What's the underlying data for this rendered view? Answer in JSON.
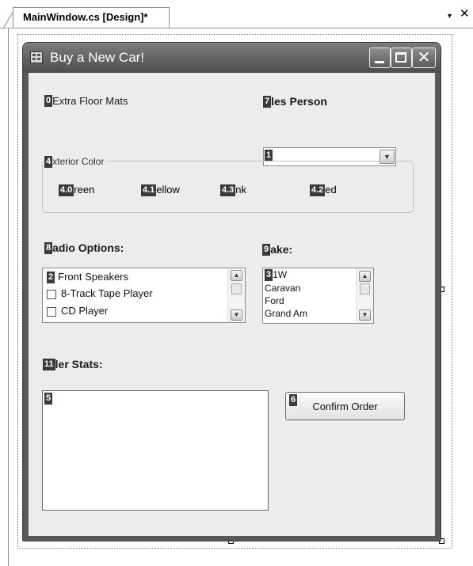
{
  "designer": {
    "tab_label": "MainWindow.cs [Design]*",
    "menu_glyph": "▾",
    "close_glyph": "✕"
  },
  "form": {
    "title": "Buy a New Car!",
    "icon": "form-icon",
    "caption_buttons": {
      "minimize": "minimize-icon",
      "maximize": "maximize-icon",
      "close": "close-icon"
    }
  },
  "controls": {
    "floor_mats": {
      "tab_index": "0",
      "label": "Extra Floor Mats"
    },
    "sales_person": {
      "tab_index": "7",
      "label": "les Person"
    },
    "sales_combo": {
      "tab_index": "1",
      "value": ""
    },
    "exterior_color": {
      "tab_index": "4",
      "title": "xterior Color",
      "options": [
        {
          "tab_index": "4.0",
          "label": "reen"
        },
        {
          "tab_index": "4.1",
          "label": "ellow"
        },
        {
          "tab_index": "4.3",
          "label": "nk"
        },
        {
          "tab_index": "4.2",
          "label": "ed"
        }
      ]
    },
    "radio_options": {
      "tab_index": "8",
      "label": "adio Options:"
    },
    "radio_list": {
      "tab_index": "2",
      "items": [
        "Front Speakers",
        "8-Track Tape Player",
        "CD Player"
      ]
    },
    "make": {
      "tab_index": "9",
      "label": "ake:"
    },
    "make_list": {
      "tab_index": "3",
      "items": [
        "1W",
        "Caravan",
        "Ford",
        "Grand Am"
      ]
    },
    "order_stats": {
      "tab_index": "11",
      "label": "ler Stats:"
    },
    "order_textbox": {
      "tab_index": "5",
      "value": ""
    },
    "confirm": {
      "tab_index": "6",
      "label": "Confirm Order"
    }
  }
}
